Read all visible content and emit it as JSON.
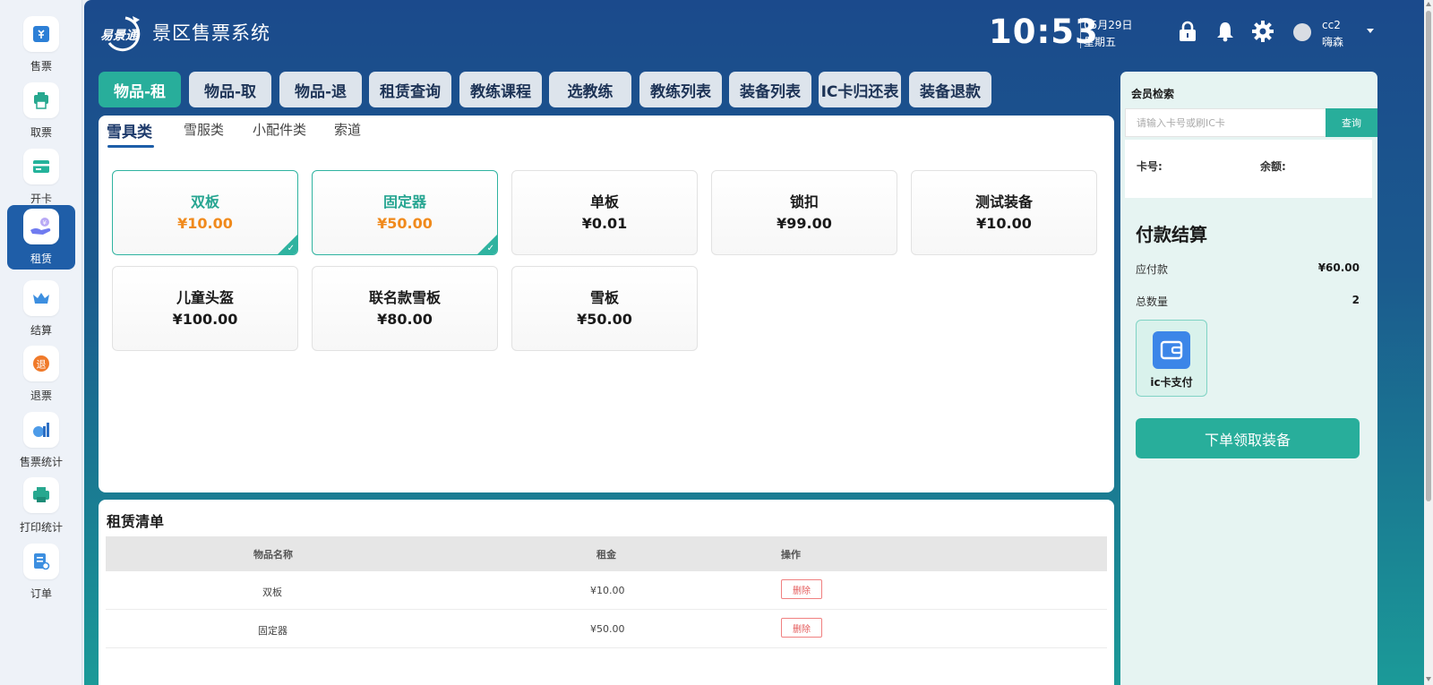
{
  "sidebar": {
    "items": [
      {
        "label": "售票",
        "icon": "ticket-icon"
      },
      {
        "label": "取票",
        "icon": "printer-icon"
      },
      {
        "label": "开卡",
        "icon": "card-icon"
      },
      {
        "label": "租赁",
        "icon": "rent-hand-yen-icon"
      },
      {
        "label": "结算",
        "icon": "crown-icon"
      },
      {
        "label": "退票",
        "icon": "refund-icon"
      },
      {
        "label": "售票统计",
        "icon": "chart-icon"
      },
      {
        "label": "打印统计",
        "icon": "print-stat-icon"
      },
      {
        "label": "订单",
        "icon": "order-icon"
      }
    ],
    "active_index": 3
  },
  "header": {
    "logo_text": "易景通",
    "title": "景区售票系统",
    "time": "10:53",
    "date": "05月29日",
    "weekday": "星期五",
    "user_id": "cc2",
    "user_name": "嗨森"
  },
  "tabs": [
    "物品-租",
    "物品-取",
    "物品-退",
    "租赁查询",
    "教练课程",
    "选教练",
    "教练列表",
    "装备列表",
    "IC卡归还表",
    "装备退款"
  ],
  "subtabs": [
    "雪具类",
    "雪服类",
    "小配件类",
    "索道"
  ],
  "products": [
    {
      "name": "双板",
      "price": "¥10.00",
      "selected": true
    },
    {
      "name": "固定器",
      "price": "¥50.00",
      "selected": true
    },
    {
      "name": "单板",
      "price": "¥0.01",
      "selected": false
    },
    {
      "name": "锁扣",
      "price": "¥99.00",
      "selected": false
    },
    {
      "name": "测试装备",
      "price": "¥10.00",
      "selected": false
    },
    {
      "name": "儿童头盔",
      "price": "¥100.00",
      "selected": false
    },
    {
      "name": "联名款雪板",
      "price": "¥80.00",
      "selected": false
    },
    {
      "name": "雪板",
      "price": "¥50.00",
      "selected": false
    }
  ],
  "rental_list": {
    "title": "租赁清单",
    "columns": [
      "物品名称",
      "租金",
      "操作"
    ],
    "rows": [
      {
        "name": "双板",
        "rent": "¥10.00",
        "action": "删除"
      },
      {
        "name": "固定器",
        "rent": "¥50.00",
        "action": "删除"
      }
    ]
  },
  "member": {
    "title": "会员检索",
    "placeholder": "请输入卡号或刷IC卡",
    "search_label": "查询",
    "card_label": "卡号:",
    "balance_label": "余额:"
  },
  "payment": {
    "title": "付款结算",
    "due_label": "应付款",
    "due_value": "¥60.00",
    "count_label": "总数量",
    "count_value": "2",
    "method_label": "ic卡支付",
    "order_button": "下单领取装备"
  },
  "colors": {
    "accent": "#28ae9b",
    "header_blue": "#1b4a8c",
    "price_orange": "#f08a1c"
  }
}
